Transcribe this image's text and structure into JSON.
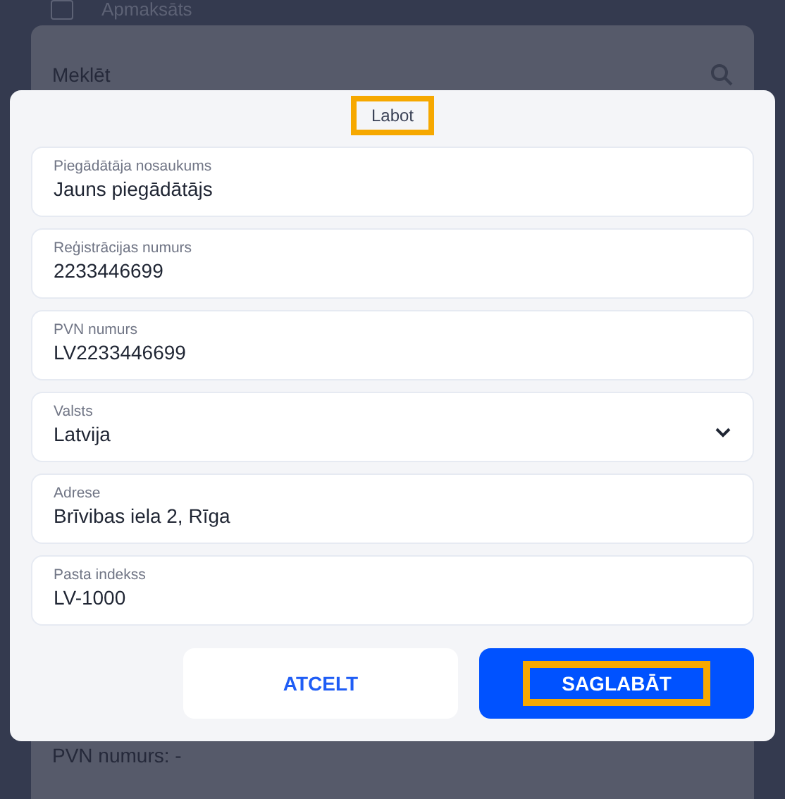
{
  "background": {
    "status_checked": false,
    "status_label": "Apmaksāts",
    "search": {
      "placeholder": "Meklēt"
    },
    "detail_line": "PVN numurs: -"
  },
  "dialog": {
    "title": "Labot",
    "title_highlighted": true,
    "fields": [
      {
        "kind": "text",
        "label": "Piegādātāja nosaukums",
        "value": "Jauns piegādātājs"
      },
      {
        "kind": "text",
        "label": "Reģistrācijas numurs",
        "value": "2233446699"
      },
      {
        "kind": "text",
        "label": "PVN numurs",
        "value": "LV2233446699"
      },
      {
        "kind": "select",
        "label": "Valsts",
        "value": "Latvija"
      },
      {
        "kind": "text",
        "label": "Adrese",
        "value": "Brīvibas iela 2, Rīga"
      },
      {
        "kind": "text",
        "label": "Pasta indekss",
        "value": "LV-1000"
      }
    ],
    "buttons": [
      {
        "kind": "secondary",
        "label": "ATCELT",
        "highlighted": false
      },
      {
        "kind": "primary",
        "label": "SAGLABĀT",
        "highlighted": true
      }
    ]
  }
}
